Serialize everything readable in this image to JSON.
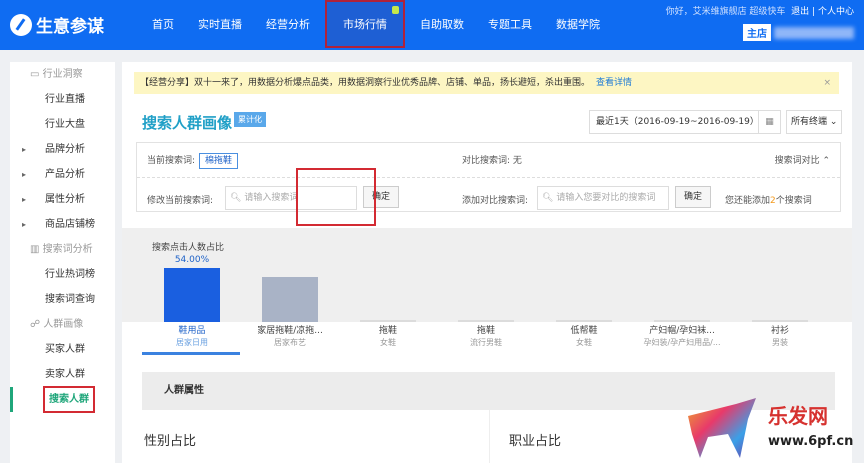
{
  "header": {
    "logo": "生意参谋",
    "nav": [
      "首页",
      "实时直播",
      "经营分析",
      "市场行情",
      "自助取数",
      "专题工具",
      "数据学院"
    ],
    "active_nav": "市场行情",
    "greeting": "你好，艾米维旗舰店 超级快车",
    "logout": "退出",
    "separator": "|",
    "user_center": "个人中心",
    "shop_badge": "主店"
  },
  "sidebar": {
    "groups": [
      {
        "label": "行业洞察",
        "icon": "monitor-icon",
        "items": [
          {
            "label": "行业直播",
            "arrow": false
          },
          {
            "label": "行业大盘",
            "arrow": false
          },
          {
            "label": "品牌分析",
            "arrow": true
          },
          {
            "label": "产品分析",
            "arrow": true
          },
          {
            "label": "属性分析",
            "arrow": true
          },
          {
            "label": "商品店铺榜",
            "arrow": true
          }
        ]
      },
      {
        "label": "搜索词分析",
        "icon": "bar-chart-icon",
        "items": [
          {
            "label": "行业热词榜"
          },
          {
            "label": "搜索词查询"
          }
        ]
      },
      {
        "label": "人群画像",
        "icon": "users-icon",
        "items": [
          {
            "label": "买家人群"
          },
          {
            "label": "卖家人群"
          },
          {
            "label": "搜索人群",
            "active": true
          }
        ]
      }
    ],
    "accent": "#1fa67a"
  },
  "notice": {
    "text": "【经营分享】双十一来了，用数据分析爆点品类，用数据洞察行业优秀品牌、店铺、单品，扬长避短，杀出重围。",
    "link": "查看详情",
    "close": "×"
  },
  "page": {
    "title": "搜索人群画像",
    "tag": "累计化",
    "date_range": "最近1天（2016-09-19~2016-09-19）",
    "terminal": "所有终端"
  },
  "search": {
    "current_label": "当前搜索词:",
    "current_value": "棉拖鞋",
    "compare_label": "对比搜索词: 无",
    "toggle": "搜索词对比",
    "toggle_icon": "chevron-up-icon",
    "modify_label": "修改当前搜索词:",
    "modify_placeholder": "请输入搜索词",
    "confirm": "确定",
    "add_label": "添加对比搜索词:",
    "add_placeholder": "请输入您要对比的搜索词",
    "remaining_prefix": "您还能添加",
    "remaining_count": "2",
    "remaining_suffix": "个搜索词"
  },
  "chart_data": {
    "type": "bar",
    "title": "搜索点击人数占比",
    "unit": "%",
    "categories": [
      "鞋用品",
      "家居拖鞋/凉拖...",
      "拖鞋",
      "拖鞋",
      "低帮鞋",
      "产妇帽/孕妇袜...",
      "衬衫"
    ],
    "subcategories": [
      "居家日用",
      "居家布艺",
      "女鞋",
      "流行男鞋",
      "女鞋",
      "孕妇装/孕产妇用品/...",
      "男装"
    ],
    "values": [
      54.0,
      45,
      0.5,
      0.5,
      0.5,
      0.5,
      0.5
    ],
    "data_labels": [
      "54.00%"
    ],
    "selected": 0,
    "colors": {
      "selected": "#1a5fe0",
      "other": "#a9b3c6"
    }
  },
  "section": {
    "title": "人群属性",
    "gender": "性别占比",
    "occupation": "职业占比"
  },
  "watermark": {
    "text": "乐发网",
    "url": "www.6pf.cn"
  }
}
